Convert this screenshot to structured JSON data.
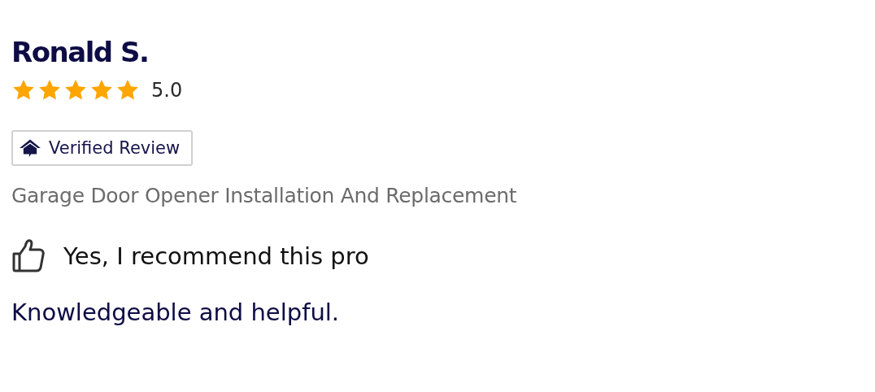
{
  "reviewer": {
    "name": "Ronald S.",
    "stars": 5,
    "rating": "5.0"
  },
  "badge": {
    "label": "Verified Review"
  },
  "service": "Garage Door Opener Installation And Replacement",
  "recommendation": {
    "recommended": true,
    "text": "Yes, I recommend this pro"
  },
  "review_text": "Knowledgeable and helpful."
}
